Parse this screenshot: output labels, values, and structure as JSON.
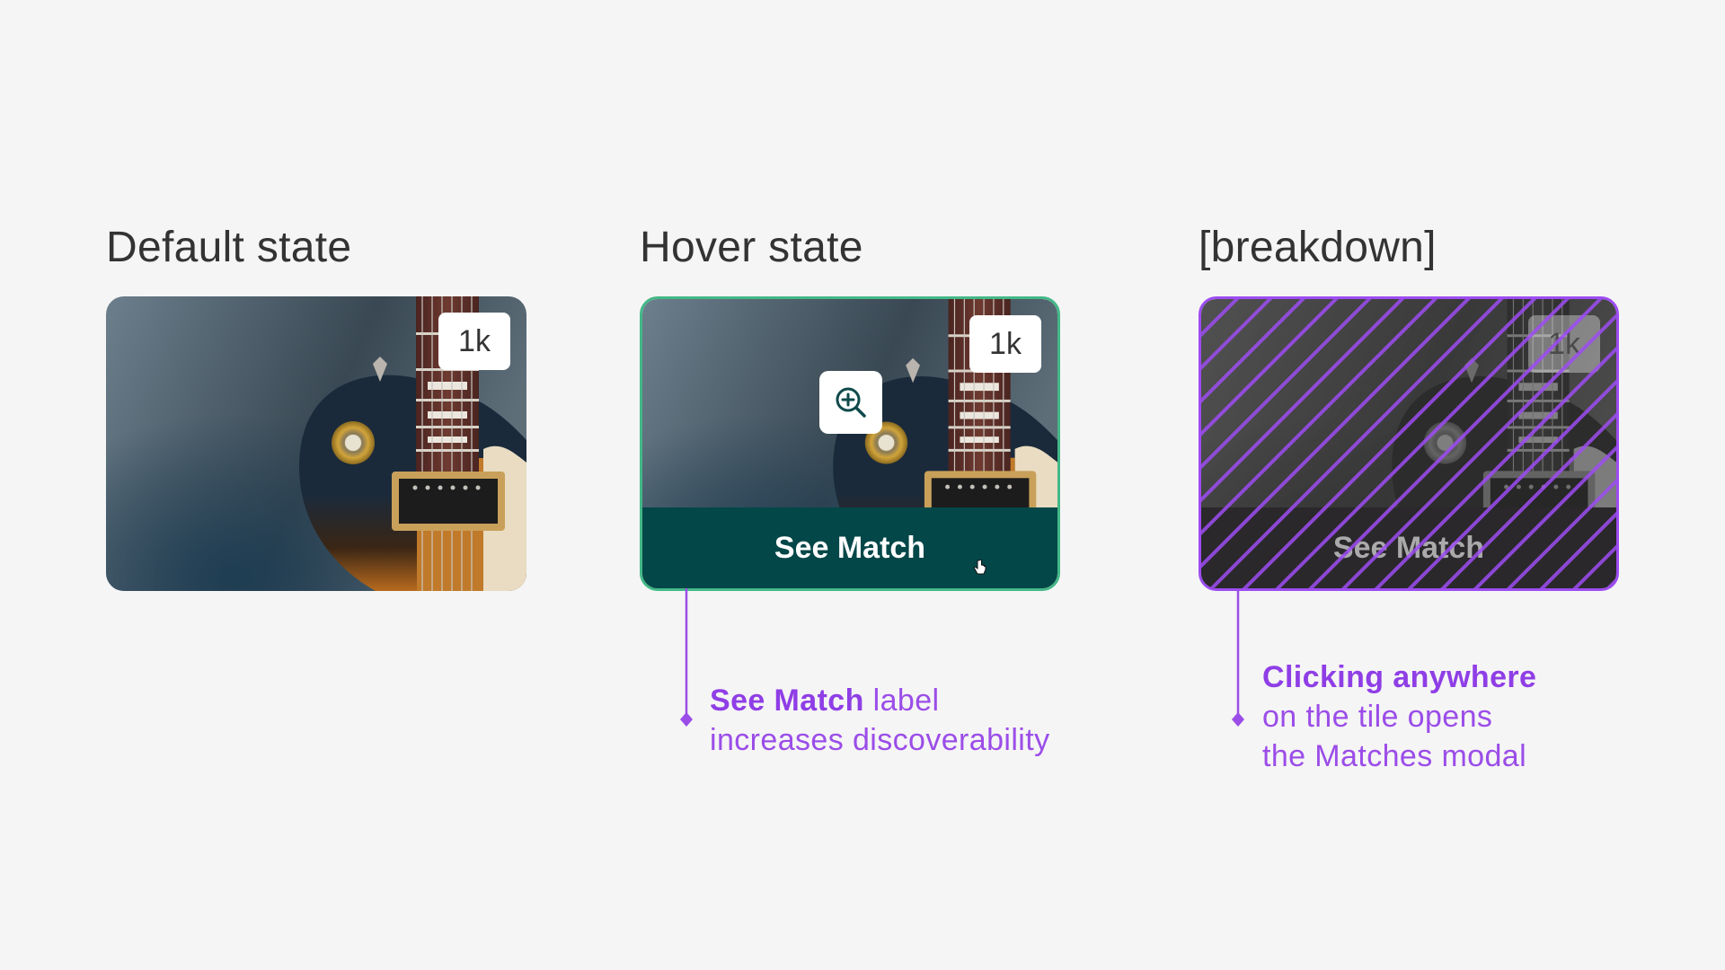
{
  "states": {
    "default": {
      "title": "Default state",
      "count_badge": "1k"
    },
    "hover": {
      "title": "Hover state",
      "count_badge": "1k",
      "action_label": "See Match"
    },
    "breakdown": {
      "title": "[breakdown]",
      "count_badge": "1k",
      "action_label": "See Match"
    }
  },
  "annotations": {
    "see_match": {
      "bold": "See Match",
      "rest1": " label",
      "rest2": "increases discoverability"
    },
    "clicking": {
      "bold": "Clicking anywhere",
      "rest1": "on the tile opens",
      "rest2": "the Matches modal"
    }
  },
  "icons": {
    "zoom": "zoom-in-icon",
    "cursor": "pointer-hand-icon"
  },
  "colors": {
    "background": "#f5f5f5",
    "hover_border": "#43b887",
    "action_bar": "#044749",
    "annotation": "#9b4de8",
    "breakdown_border": "#9d4cf2"
  }
}
